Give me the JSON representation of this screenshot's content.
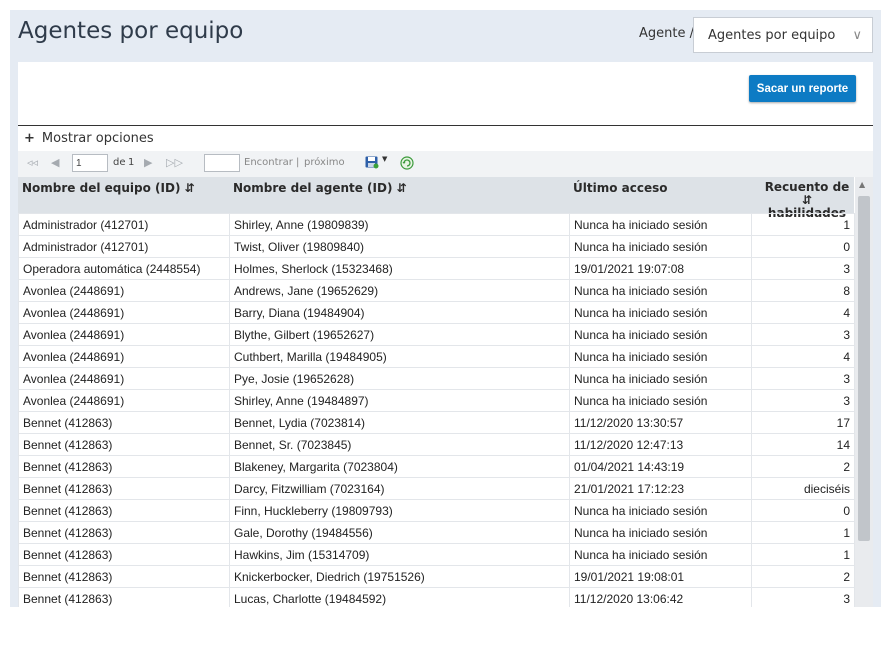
{
  "header": {
    "title": "Agentes por equipo",
    "breadcrumb": "Agente /",
    "view_select": "Agentes por equipo"
  },
  "actions": {
    "report_button": "Sacar un reporte"
  },
  "options": {
    "toggle_label": "Mostrar opciones"
  },
  "toolbar": {
    "page_value": "1",
    "page_of": "de",
    "page_total": "1",
    "find_label": "Encontrar",
    "separator": "|",
    "next_label": "próximo"
  },
  "table": {
    "columns": [
      "Nombre del equipo (ID)",
      "Nombre del agente (ID)",
      "Último acceso",
      "Recuento de",
      "habilidades"
    ],
    "rows": [
      [
        "Administrador (412701)",
        "Shirley, Anne (19809839)",
        "Nunca ha iniciado sesión",
        "1"
      ],
      [
        "Administrador (412701)",
        "Twist, Oliver (19809840)",
        "Nunca ha iniciado sesión",
        "0"
      ],
      [
        "Operadora automática (2448554)",
        "Holmes, Sherlock (15323468)",
        "19/01/2021 19:07:08",
        "3"
      ],
      [
        "Avonlea (2448691)",
        "Andrews, Jane (19652629)",
        "Nunca ha iniciado sesión",
        "8"
      ],
      [
        "Avonlea (2448691)",
        "Barry, Diana (19484904)",
        "Nunca ha iniciado sesión",
        "4"
      ],
      [
        "Avonlea (2448691)",
        "Blythe, Gilbert (19652627)",
        "Nunca ha iniciado sesión",
        "3"
      ],
      [
        "Avonlea (2448691)",
        "Cuthbert, Marilla (19484905)",
        "Nunca ha iniciado sesión",
        "4"
      ],
      [
        "Avonlea (2448691)",
        "Pye, Josie (19652628)",
        "Nunca ha iniciado sesión",
        "3"
      ],
      [
        "Avonlea (2448691)",
        "Shirley, Anne (19484897)",
        "Nunca ha iniciado sesión",
        "3"
      ],
      [
        "Bennet (412863)",
        "Bennet, Lydia (7023814)",
        "11/12/2020 13:30:57",
        "17"
      ],
      [
        "Bennet (412863)",
        "Bennet, Sr. (7023845)",
        "11/12/2020 12:47:13",
        "14"
      ],
      [
        "Bennet (412863)",
        "Blakeney, Margarita (7023804)",
        "01/04/2021 14:43:19",
        "2"
      ],
      [
        "Bennet (412863)",
        "Darcy, Fitzwilliam (7023164)",
        "21/01/2021 17:12:23",
        "dieciséis"
      ],
      [
        "Bennet (412863)",
        "Finn, Huckleberry (19809793)",
        "Nunca ha iniciado sesión",
        "0"
      ],
      [
        "Bennet (412863)",
        "Gale, Dorothy (19484556)",
        "Nunca ha iniciado sesión",
        "1"
      ],
      [
        "Bennet (412863)",
        "Hawkins, Jim (15314709)",
        "Nunca ha iniciado sesión",
        "1"
      ],
      [
        "Bennet (412863)",
        "Knickerbocker, Diedrich (19751526)",
        "19/01/2021 19:08:01",
        "2"
      ],
      [
        "Bennet (412863)",
        "Lucas, Charlotte (19484592)",
        "11/12/2020 13:06:42",
        "3"
      ]
    ]
  },
  "icons": {
    "first_page": "first-page-icon",
    "prev_page": "prev-page-icon",
    "next_page": "next-page-icon",
    "last_page": "last-page-icon",
    "export": "save-icon",
    "refresh": "refresh-icon",
    "sort": "sort-icon"
  },
  "colors": {
    "accent": "#0d7bc4",
    "background": "#e5ebf3",
    "header_row": "#dde2e7"
  }
}
